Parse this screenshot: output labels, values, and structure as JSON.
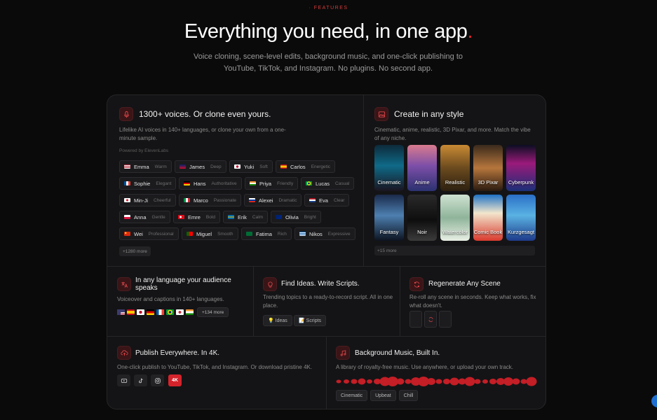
{
  "header": {
    "eyebrow": "· FEATURES",
    "headline": "Everything you need, in one app",
    "headline_dot": ".",
    "subline": "Voice cloning, scene-level edits, background music, and one-click publishing to YouTube, TikTok, and Instagram. No plugins. No second app."
  },
  "voices": {
    "icon": "microphone-icon",
    "title": "1300+ voices. Or clone even yours.",
    "desc": "Lifelike AI voices in 140+ languages, or clone your own from a one-minute sample.",
    "powered": "Powered by ElevenLabs",
    "chips": [
      {
        "name": "Emma",
        "tag": "Warm",
        "flag": "us"
      },
      {
        "name": "James",
        "tag": "Deep",
        "flag": "gb"
      },
      {
        "name": "Yuki",
        "tag": "Soft",
        "flag": "jp"
      },
      {
        "name": "Carlos",
        "tag": "Energetic",
        "flag": "es"
      },
      {
        "name": "Sophie",
        "tag": "Elegant",
        "flag": "fr"
      },
      {
        "name": "Hans",
        "tag": "Authoritative",
        "flag": "de"
      },
      {
        "name": "Priya",
        "tag": "Friendly",
        "flag": "in"
      },
      {
        "name": "Lucas",
        "tag": "Casual",
        "flag": "br"
      },
      {
        "name": "Min-Ji",
        "tag": "Cheerful",
        "flag": "kr"
      },
      {
        "name": "Marco",
        "tag": "Passionate",
        "flag": "it"
      },
      {
        "name": "Alexei",
        "tag": "Dramatic",
        "flag": "ru"
      },
      {
        "name": "Eva",
        "tag": "Clear",
        "flag": "nl"
      },
      {
        "name": "Anna",
        "tag": "Gentle",
        "flag": "pl"
      },
      {
        "name": "Emre",
        "tag": "Bold",
        "flag": "tr"
      },
      {
        "name": "Erik",
        "tag": "Calm",
        "flag": "se"
      },
      {
        "name": "Olivia",
        "tag": "Bright",
        "flag": "au"
      },
      {
        "name": "Wei",
        "tag": "Professional",
        "flag": "cn"
      },
      {
        "name": "Miguel",
        "tag": "Smooth",
        "flag": "pt"
      },
      {
        "name": "Fatima",
        "tag": "Rich",
        "flag": "sa"
      },
      {
        "name": "Nikos",
        "tag": "Expressive",
        "flag": "gr"
      }
    ],
    "more": "+1280 more"
  },
  "style": {
    "icon": "image-icon",
    "title": "Create in any style",
    "desc": "Cinematic, anime, realistic, 3D Pixar, and more. Match the vibe of any niche.",
    "tiles": [
      "Cinematic",
      "Anime",
      "Realistic",
      "3D Pixar",
      "Cyberpunk",
      "Fantasy",
      "Noir",
      "Watercolor",
      "Comic Book",
      "Kurzgesagt"
    ],
    "more": "+15 more"
  },
  "language": {
    "icon": "translate-icon",
    "title": "In any language your audience speaks",
    "desc": "Voiceover and captions in 140+ languages.",
    "more": "+134 more"
  },
  "ideas": {
    "icon": "lightbulb-icon",
    "title": "Find Ideas. Write Scripts.",
    "desc": "Trending topics to a ready-to-record script. All in one place.",
    "chip_ideas": "💡 Ideas",
    "chip_scripts": "📝 Scripts"
  },
  "regen": {
    "icon": "refresh-icon",
    "title": "Regenerate Any Scene",
    "desc": "Re-roll any scene in seconds. Keep what works, fix what doesn't."
  },
  "publish": {
    "icon": "upload-cloud-icon",
    "title": "Publish Everywhere. In 4K.",
    "desc": "One-click publish to YouTube, TikTok, and Instagram. Or download pristine 4K.",
    "badge": "4K"
  },
  "music": {
    "icon": "music-icon",
    "title": "Background Music, Built In.",
    "desc": "A library of royalty-free music. Use anywhere, or upload your own track.",
    "genres": [
      "Cinematic",
      "Upbeat",
      "Chill"
    ]
  },
  "colors": {
    "accent": "#e3262d",
    "bg": "#0a0a0a",
    "card": "#141416"
  }
}
